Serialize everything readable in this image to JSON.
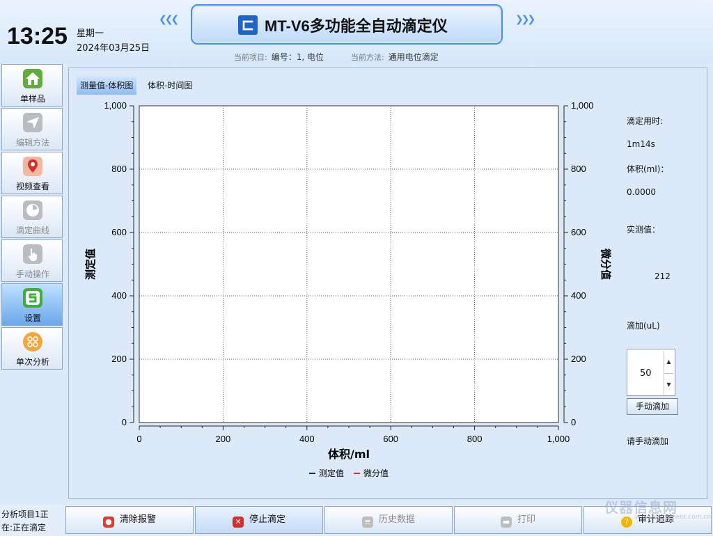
{
  "header": {
    "time": "13:25",
    "weekday": "星期一",
    "date": "2024年03月25日",
    "title": "MT-V6多功能全自动滴定仪",
    "current_item_label": "当前项目:",
    "current_item_value": "编号：1, 电位",
    "current_method_label": "当前方法:",
    "current_method_value": "通用电位滴定"
  },
  "sidebar": {
    "items": [
      {
        "label": "单样品",
        "icon": "home-icon",
        "enabled": true
      },
      {
        "label": "编辑方法",
        "icon": "send-icon",
        "enabled": false
      },
      {
        "label": "视频查看",
        "icon": "location-pin-icon",
        "enabled": true
      },
      {
        "label": "滴定曲线",
        "icon": "clock-icon",
        "enabled": false
      },
      {
        "label": "手动操作",
        "icon": "hand-icon",
        "enabled": false
      },
      {
        "label": "设置",
        "icon": "settings-s-icon",
        "enabled": true,
        "active": true
      },
      {
        "label": "单次分析",
        "icon": "grid-icon",
        "enabled": true
      }
    ]
  },
  "tabs": [
    "测量值-体积图",
    "体积-时间图"
  ],
  "chart_data": {
    "type": "line",
    "xlabel": "体积/ml",
    "ylabel": "测定值",
    "y2label": "微分值",
    "xlim": [
      0,
      1000
    ],
    "ylim": [
      0,
      1000
    ],
    "y2lim": [
      0,
      1000
    ],
    "x_ticks": [
      "0",
      "200",
      "400",
      "600",
      "800",
      "1,000"
    ],
    "y_ticks": [
      "0",
      "200",
      "400",
      "600",
      "800",
      "1,000"
    ],
    "grid": true,
    "legend_placement": "bottom",
    "series": [
      {
        "name": "测定值",
        "color": "#1a237e",
        "x": [],
        "y": []
      },
      {
        "name": "微分值",
        "color": "#d32f2f",
        "x": [],
        "y": []
      }
    ]
  },
  "panel": {
    "time_label": "滴定用时:",
    "time_value": "1m14s",
    "volume_label": "体积(ml)：",
    "volume_value": "0.0000",
    "measured_label": "实测值：",
    "measured_value": "212",
    "add_label": "滴加(uL)",
    "add_value": "50",
    "manual_button": "手动滴加",
    "prompt": "请手动滴加"
  },
  "status": {
    "line1": "分析项目1正",
    "line2": "在:正在滴定"
  },
  "bottom_buttons": [
    {
      "label": "清除报警",
      "icon": "alarm-light-icon",
      "enabled": true
    },
    {
      "label": "停止滴定",
      "icon": "stop-icon",
      "enabled": true
    },
    {
      "label": "历史数据",
      "icon": "document-icon",
      "enabled": false
    },
    {
      "label": "打印",
      "icon": "printer-icon",
      "enabled": false
    },
    {
      "label": "审计追踪",
      "icon": "help-icon",
      "enabled": true
    }
  ],
  "watermark": "仪器信息网"
}
